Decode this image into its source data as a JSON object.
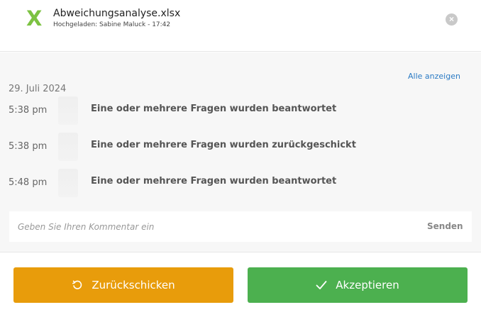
{
  "header": {
    "file_name": "Abweichungsanalyse.xlsx",
    "meta": "Hochgeladen: Sabine Maluck - 17:42",
    "file_icon_letter": "X",
    "file_icon": "excel-icon",
    "close_icon": "close-icon",
    "close_glyph": "×"
  },
  "activity": {
    "show_all_label": "Alle anzeigen",
    "date": "29. Juli 2024",
    "events": [
      {
        "time": "5:38 pm",
        "text": "Eine oder mehrere Fragen wurden beantwortet"
      },
      {
        "time": "5:38 pm",
        "text": "Eine oder mehrere Fragen wurden zurückgeschickt"
      },
      {
        "time": "5:48 pm",
        "text": "Eine oder mehrere Fragen wurden beantwortet"
      }
    ]
  },
  "comment": {
    "placeholder": "Geben Sie Ihren Kommentar ein",
    "value": "",
    "send_label": "Senden"
  },
  "actions": {
    "return_label": "Zurückschicken",
    "return_icon": "undo-icon",
    "accept_label": "Akzeptieren",
    "accept_icon": "check-icon"
  },
  "colors": {
    "excel_green": "#7cc242",
    "link_blue": "#2b7bc4",
    "return_orange": "#e89c0b",
    "accept_green": "#4cb04f"
  }
}
